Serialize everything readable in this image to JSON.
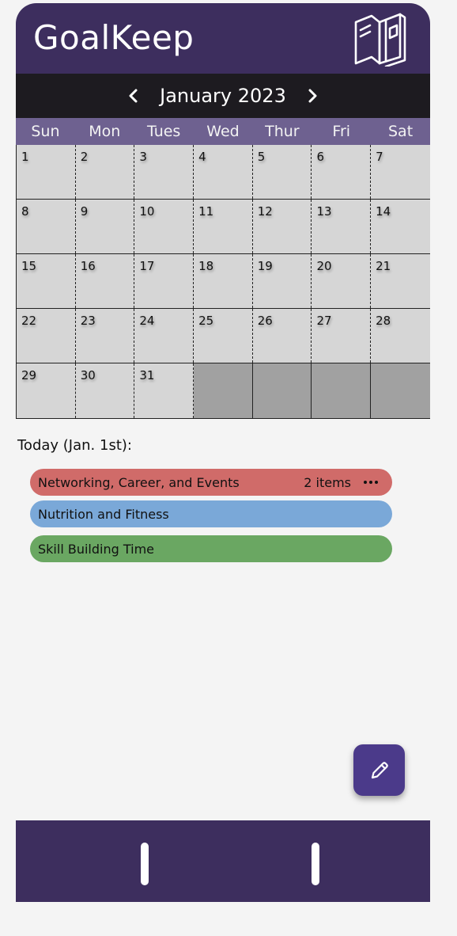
{
  "app": {
    "title": "GoalKeep",
    "logo_icon": "book-icon",
    "colors": {
      "header": "#3d2e5e",
      "month_bar": "#1d1b20",
      "weekday_bar": "#6e6190",
      "fab": "#4b3a8a"
    }
  },
  "calendar": {
    "month_label": "January 2023",
    "prev_icon": "chevron-left-icon",
    "next_icon": "chevron-right-icon",
    "weekdays": [
      "Sun",
      "Mon",
      "Tues",
      "Wed",
      "Thur",
      "Fri",
      "Sat"
    ],
    "weeks": [
      [
        "1",
        "2",
        "3",
        "4",
        "5",
        "6",
        "7"
      ],
      [
        "8",
        "9",
        "10",
        "11",
        "12",
        "13",
        "14"
      ],
      [
        "15",
        "16",
        "17",
        "18",
        "19",
        "20",
        "21"
      ],
      [
        "22",
        "23",
        "24",
        "25",
        "26",
        "27",
        "28"
      ],
      [
        "29",
        "30",
        "31",
        "",
        "",
        "",
        ""
      ]
    ]
  },
  "today": {
    "label": "Today (Jan. 1st):",
    "categories": [
      {
        "name": "Networking, Career, and Events",
        "count": "2 items",
        "color": "#d06b69",
        "has_more": true
      },
      {
        "name": "Nutrition and Fitness",
        "count": "",
        "color": "#7aa8d8",
        "has_more": false
      },
      {
        "name": "Skill Building Time",
        "count": "",
        "color": "#6aa762",
        "has_more": false
      }
    ]
  },
  "fab": {
    "icon": "pencil-icon"
  }
}
